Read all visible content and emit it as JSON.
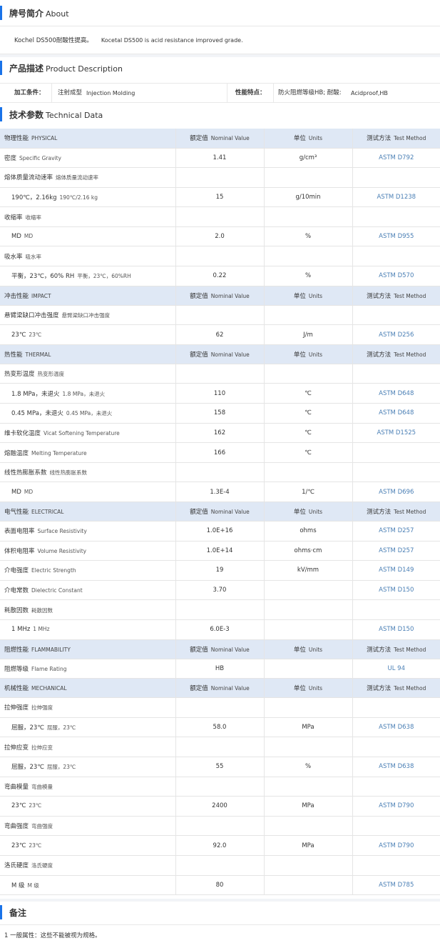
{
  "about": {
    "title": "牌号简介",
    "title_en": "About",
    "text_cn": "Kochel DS500耐酸性提高。",
    "text_en": "Kocetal DS500 is acid resistance improved grade."
  },
  "product_description": {
    "title": "产品描述",
    "title_en": "Product Description",
    "processing_label": "加工条件：",
    "processing_cn": "注射成型",
    "processing_en": "Injection Molding",
    "features_label": "性能特点：",
    "features_cn": "防火阻燃等级HB; 耐酸:",
    "features_en": "Acidproof,HB"
  },
  "technical_data": {
    "title": "技术参数",
    "title_en": "Technical Data",
    "header": {
      "value_cn": "额定值",
      "value_en": "Nominal Value",
      "unit_cn": "单位",
      "unit_en": "Units",
      "method_cn": "测试方法",
      "method_en": "Test Method"
    },
    "rows": [
      {
        "type": "hdr",
        "cn": "物理性能",
        "en": "PHYSICAL"
      },
      {
        "cn": "密度",
        "en": "Specific Gravity",
        "value": "1.41",
        "unit": "g/cm³",
        "method": "ASTM D792"
      },
      {
        "cn": "熔体质量流动速率",
        "en": "熔体质量流动速率",
        "value": "",
        "unit": "",
        "method": ""
      },
      {
        "indent": true,
        "cn": "190℃，2.16kg",
        "en": "190℃/2.16 kg",
        "value": "15",
        "unit": "g/10min",
        "method": "ASTM D1238"
      },
      {
        "cn": "收缩率",
        "en": "收缩率",
        "value": "",
        "unit": "",
        "method": ""
      },
      {
        "indent": true,
        "cn": "MD",
        "en": "MD",
        "value": "2.0",
        "unit": "%",
        "method": "ASTM D955"
      },
      {
        "cn": "吸水率",
        "en": "吸水率",
        "value": "",
        "unit": "",
        "method": ""
      },
      {
        "indent": true,
        "cn": "平衡，23℃，60% RH",
        "en": "平衡，23℃，60%RH",
        "value": "0.22",
        "unit": "%",
        "method": "ASTM D570"
      },
      {
        "type": "hdr",
        "cn": "冲击性能",
        "en": "IMPACT"
      },
      {
        "cn": "悬臂梁缺口冲击强度",
        "en": "悬臂梁缺口冲击强度",
        "value": "",
        "unit": "",
        "method": ""
      },
      {
        "indent": true,
        "cn": "23℃",
        "en": "23℃",
        "value": "62",
        "unit": "J/m",
        "method": "ASTM D256"
      },
      {
        "type": "hdr",
        "cn": "热性能",
        "en": "THERMAL"
      },
      {
        "cn": "热变形温度",
        "en": "热变形温度",
        "value": "",
        "unit": "",
        "method": ""
      },
      {
        "indent": true,
        "cn": "1.8 MPa，未退火",
        "en": "1.8 MPa，未退火",
        "value": "110",
        "unit": "℃",
        "method": "ASTM D648"
      },
      {
        "indent": true,
        "cn": "0.45 MPa，未退火",
        "en": "0.45 MPa，未退火",
        "value": "158",
        "unit": "℃",
        "method": "ASTM D648"
      },
      {
        "cn": "维卡软化温度",
        "en": "Vicat Softening Temperature",
        "value": "162",
        "unit": "℃",
        "method": "ASTM D1525"
      },
      {
        "cn": "熔融温度",
        "en": "Melting Temperature",
        "value": "166",
        "unit": "℃",
        "method": ""
      },
      {
        "cn": "线性热膨胀系数",
        "en": "线性热膨胀系数",
        "value": "",
        "unit": "",
        "method": ""
      },
      {
        "indent": true,
        "cn": "MD",
        "en": "MD",
        "value": "1.3E-4",
        "unit": "1/℃",
        "method": "ASTM D696"
      },
      {
        "type": "hdr",
        "cn": "电气性能",
        "en": "ELECTRICAL"
      },
      {
        "cn": "表面电阻率",
        "en": "Surface Resistivity",
        "value": "1.0E+16",
        "unit": "ohms",
        "method": "ASTM D257"
      },
      {
        "cn": "体积电阻率",
        "en": "Volume Resistivity",
        "value": "1.0E+14",
        "unit": "ohms·cm",
        "method": "ASTM D257"
      },
      {
        "cn": "介电强度",
        "en": "Electric Strength",
        "value": "19",
        "unit": "kV/mm",
        "method": "ASTM D149"
      },
      {
        "cn": "介电常数",
        "en": "Dielectric Constant",
        "value": "3.70",
        "unit": "",
        "method": "ASTM D150"
      },
      {
        "cn": "耗散因数",
        "en": "耗散因数",
        "value": "",
        "unit": "",
        "method": ""
      },
      {
        "indent": true,
        "cn": "1 MHz",
        "en": "1 MHz",
        "value": "6.0E-3",
        "unit": "",
        "method": "ASTM D150"
      },
      {
        "type": "hdr",
        "cn": "阻燃性能",
        "en": "FLAMMABILITY"
      },
      {
        "cn": "阻燃等级",
        "en": "Flame Rating",
        "value": "HB",
        "unit": "",
        "method": "UL 94"
      },
      {
        "type": "hdr",
        "cn": "机械性能",
        "en": "MECHANICAL"
      },
      {
        "cn": "拉伸强度",
        "en": "拉伸强度",
        "value": "",
        "unit": "",
        "method": ""
      },
      {
        "indent": true,
        "cn": "屈服，23℃",
        "en": "屈服，23℃",
        "value": "58.0",
        "unit": "MPa",
        "method": "ASTM D638"
      },
      {
        "cn": "拉伸应变",
        "en": "拉伸应变",
        "value": "",
        "unit": "",
        "method": ""
      },
      {
        "indent": true,
        "cn": "屈服，23℃",
        "en": "屈服，23℃",
        "value": "55",
        "unit": "%",
        "method": "ASTM D638"
      },
      {
        "cn": "弯曲模量",
        "en": "弯曲模量",
        "value": "",
        "unit": "",
        "method": ""
      },
      {
        "indent": true,
        "cn": "23℃",
        "en": "23℃",
        "value": "2400",
        "unit": "MPa",
        "method": "ASTM D790"
      },
      {
        "cn": "弯曲强度",
        "en": "弯曲强度",
        "value": "",
        "unit": "",
        "method": ""
      },
      {
        "indent": true,
        "cn": "23℃",
        "en": "23℃",
        "value": "92.0",
        "unit": "MPa",
        "method": "ASTM D790"
      },
      {
        "cn": "洛氏硬度",
        "en": "洛氏硬度",
        "value": "",
        "unit": "",
        "method": ""
      },
      {
        "indent": true,
        "cn": "M 级",
        "en": "M 级",
        "value": "80",
        "unit": "",
        "method": "ASTM D785"
      }
    ]
  },
  "notes": {
    "title": "备注",
    "text": "1 一般属性：这些不能被视为规格。"
  }
}
